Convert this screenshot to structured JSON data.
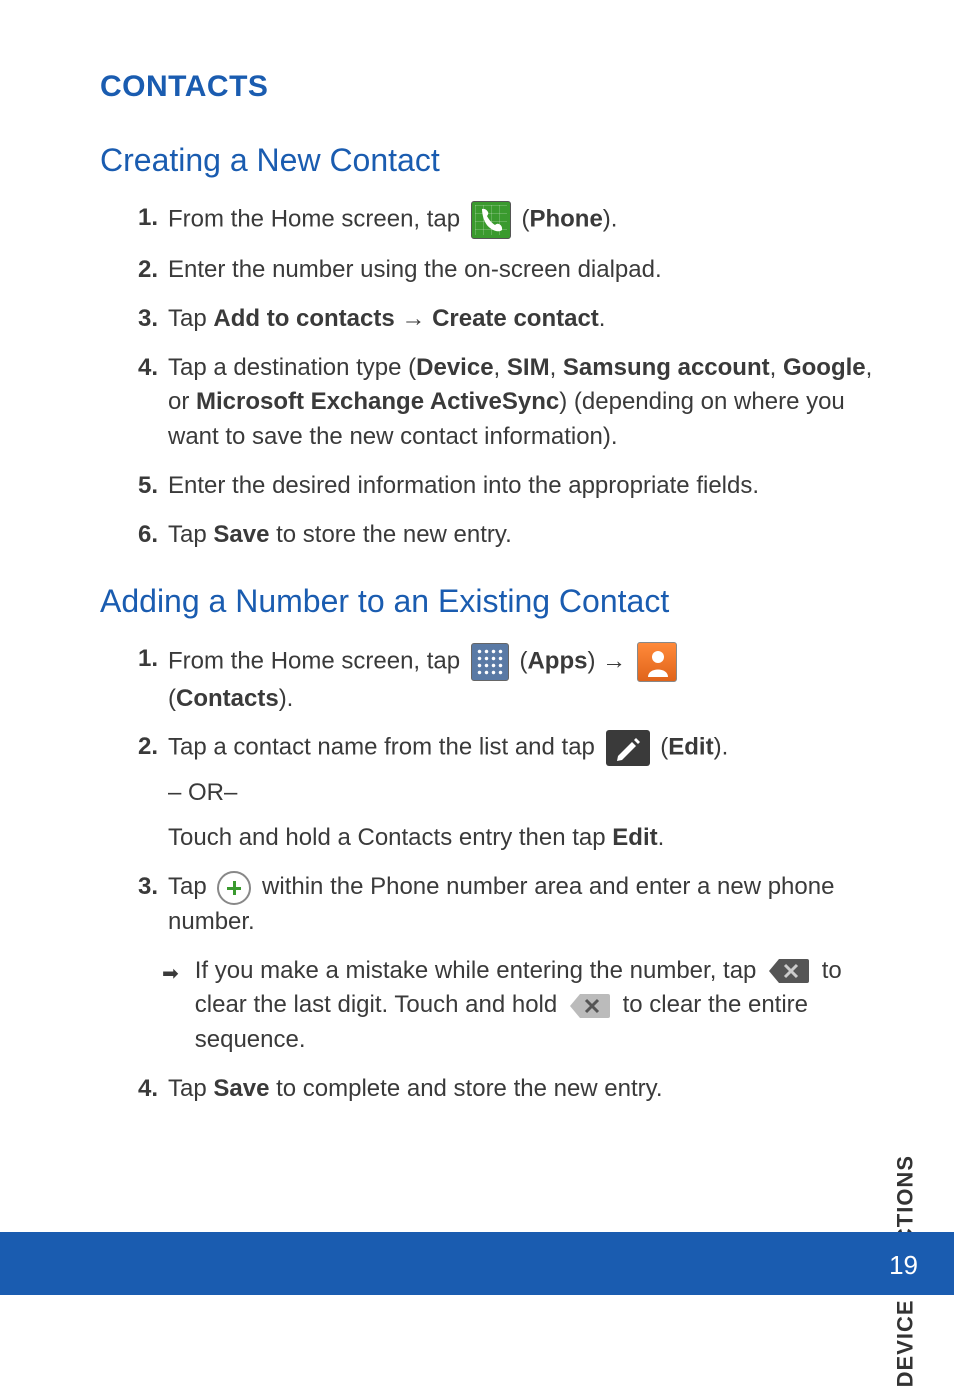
{
  "section_title": "CONTACTS",
  "side_label": "DEVICE FUNCTIONS",
  "page_number": "19",
  "section1": {
    "title": "Creating a New Contact",
    "steps": [
      {
        "num": "1.",
        "pre": "From the Home screen, tap ",
        "icon": "phone",
        "post_open": " (",
        "bold": "Phone",
        "post_close": ")."
      },
      {
        "num": "2.",
        "text": "Enter the number using the on-screen dialpad."
      },
      {
        "num": "3.",
        "pre": "Tap ",
        "b1": "Add to contacts",
        "arrow": " → ",
        "b2": "Create contact",
        "tail": "."
      },
      {
        "num": "4.",
        "pre": "Tap a destination type (",
        "b1": "Device",
        "c1": ", ",
        "b2": "SIM",
        "c2": ", ",
        "b3": "Samsung account",
        "c3": ", ",
        "b4": "Google",
        "c4": ", or ",
        "b5": "Microsoft Exchange ActiveSync",
        "tail": ") (depending on where you want to save the new contact information)."
      },
      {
        "num": "5.",
        "text": "Enter the desired information into the appropriate fields."
      },
      {
        "num": "6.",
        "pre": "Tap ",
        "b1": "Save",
        "tail": " to store the new entry."
      }
    ]
  },
  "section2": {
    "title": "Adding a Number to an Existing Contact",
    "steps": [
      {
        "num": "1.",
        "pre": "From the Home screen, tap ",
        "icon1": "apps",
        "mid_open": " (",
        "b1": "Apps",
        "mid_close": ") ",
        "arrow": "→",
        "icon2": "contacts",
        "line2_open": "(",
        "b2": "Contacts",
        "line2_close": ")."
      },
      {
        "num": "2.",
        "pre": "Tap a contact name from the list and tap ",
        "icon": "edit",
        "post_open": " (",
        "b1": "Edit",
        "post_close": ").",
        "or": "– OR–",
        "alt_pre": "Touch and hold a Contacts entry then tap ",
        "alt_b": "Edit",
        "alt_tail": "."
      },
      {
        "num": "3.",
        "pre": "Tap ",
        "icon": "plus",
        "post": " within the Phone number area and enter a new phone number.",
        "bullet_pre": "If you make a mistake while entering the number, tap ",
        "bullet_mid": " to clear the last digit. Touch and hold ",
        "bullet_tail": " to clear the entire sequence."
      },
      {
        "num": "4.",
        "pre": "Tap ",
        "b1": "Save",
        "tail": " to complete and store the new entry."
      }
    ]
  }
}
